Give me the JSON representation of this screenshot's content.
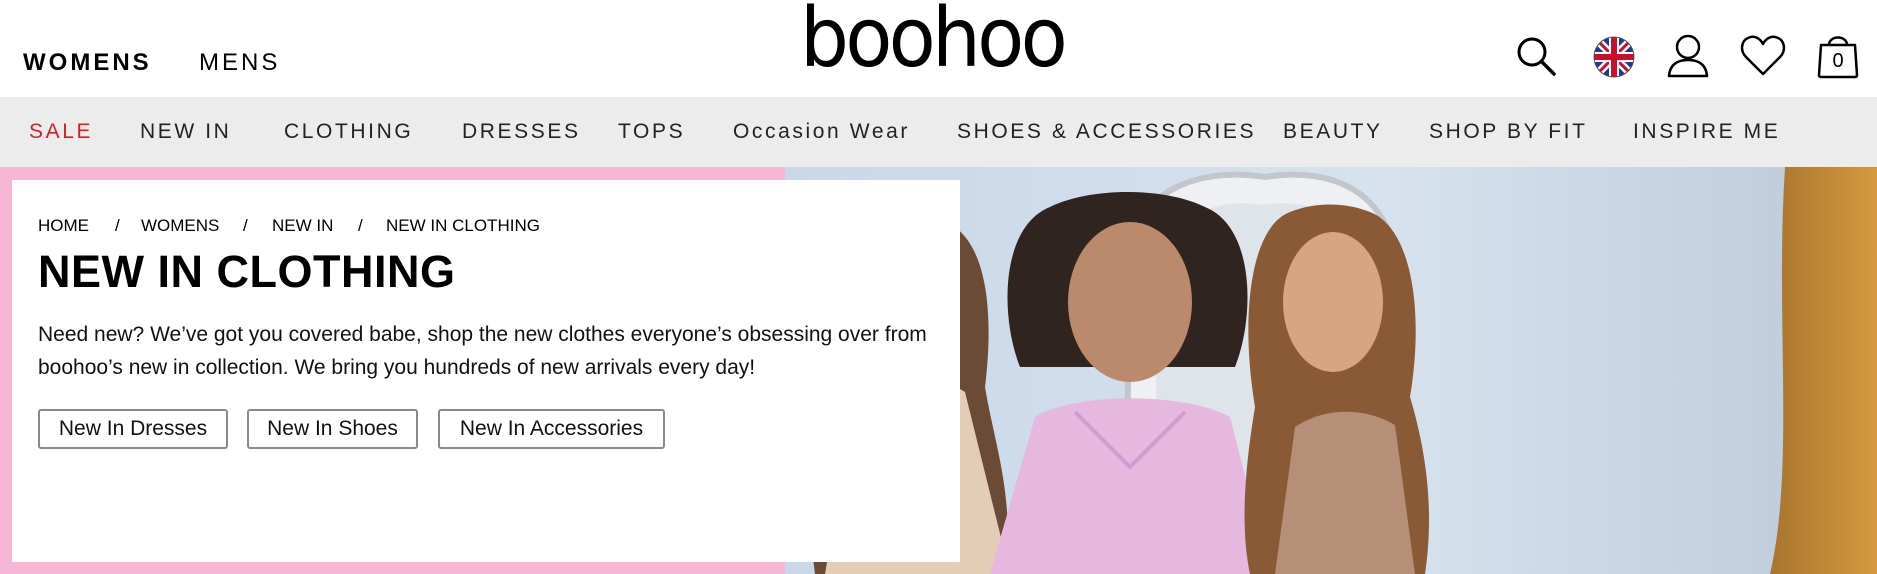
{
  "header": {
    "nav": {
      "womens": "WOMENS",
      "mens": "MENS"
    },
    "logo_text": "boohoo",
    "icons": [
      "search-icon",
      "uk-flag-icon",
      "account-icon",
      "wishlist-heart-icon",
      "shopping-bag-icon"
    ],
    "bag_count": "0"
  },
  "categories": [
    {
      "label": "SALE",
      "color": "#d0202e"
    },
    {
      "label": "NEW IN"
    },
    {
      "label": "CLOTHING"
    },
    {
      "label": "DRESSES"
    },
    {
      "label": "TOPS"
    },
    {
      "label": "Occasion Wear"
    },
    {
      "label": "SHOES & ACCESSORIES"
    },
    {
      "label": "BEAUTY"
    },
    {
      "label": "SHOP BY FIT"
    },
    {
      "label": "INSPIRE ME"
    }
  ],
  "hero": {
    "breadcrumb": [
      "HOME",
      "WOMENS",
      "NEW IN",
      "NEW IN CLOTHING"
    ],
    "breadcrumb_separator": "/",
    "title": "NEW IN CLOTHING",
    "intro": "Need new? We’ve got you covered babe, shop the new clothes everyone’s obsessing over from boohoo’s new in collection. We bring you hundreds of new arrivals every day!",
    "links": [
      "New In Dresses",
      "New In Shoes",
      "New In Accessories"
    ],
    "accent_color": "#f7b6d6"
  }
}
